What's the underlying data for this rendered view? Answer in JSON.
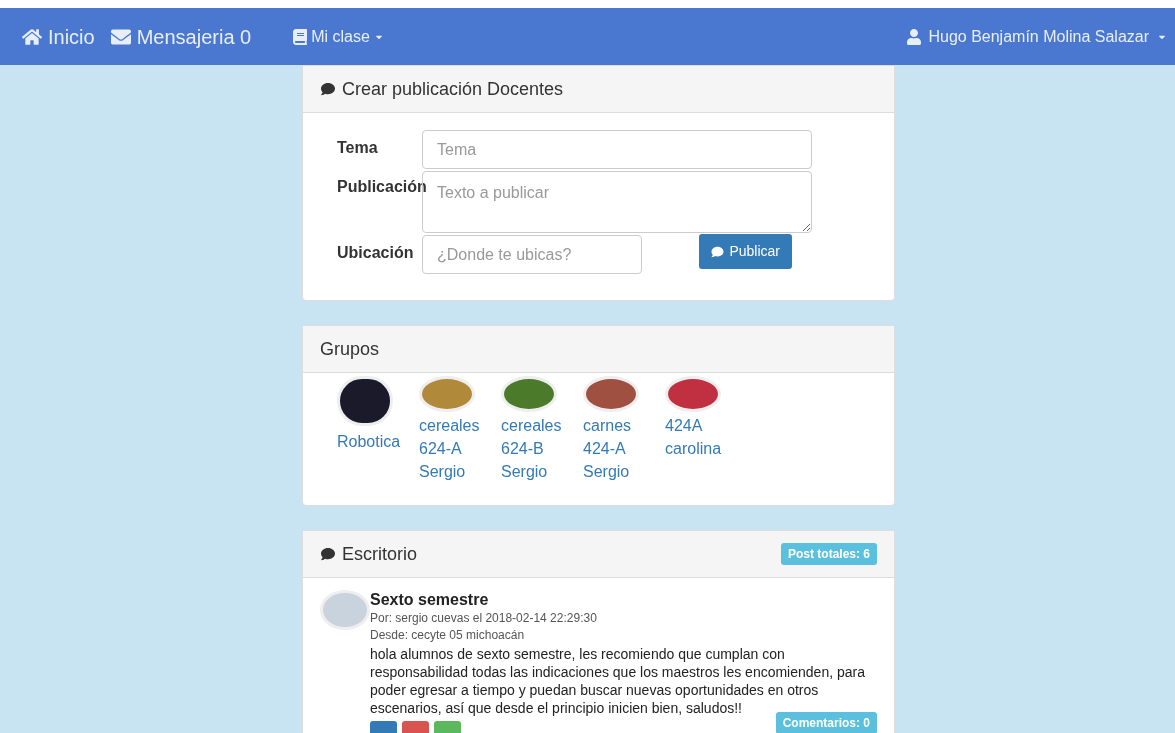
{
  "navbar": {
    "items": [
      {
        "kind": "home",
        "label": "Inicio"
      },
      {
        "kind": "mail",
        "label": "Mensajeria 0"
      },
      {
        "kind": "dropdown",
        "label": "Mi clase"
      }
    ],
    "user": "Hugo Benjamín Molina Salazar"
  },
  "create_post": {
    "title": "Crear publicación Docentes",
    "fields": [
      {
        "label": "Tema",
        "placeholder": "Tema",
        "kind": "input"
      },
      {
        "label": "Publicación",
        "placeholder": "Texto a publicar",
        "kind": "textarea"
      },
      {
        "label": "Ubicación",
        "placeholder": "¿Donde te ubicas?",
        "kind": "short"
      }
    ],
    "submit": "Publicar"
  },
  "groups": {
    "title": "Grupos",
    "items": [
      {
        "name": "Robotica",
        "color": "#1a1a2a"
      },
      {
        "name": "cereales 624-A Sergio",
        "color": "#b08a3a"
      },
      {
        "name": "cereales 624-B Sergio",
        "color": "#4a7a2a"
      },
      {
        "name": "carnes 424-A Sergio",
        "color": "#a05040"
      },
      {
        "name": "424A carolina",
        "color": "#c03040"
      }
    ]
  },
  "desk": {
    "title": "Escritorio",
    "badge": "Post totales: 6",
    "posts": [
      {
        "title": "Sexto semestre",
        "by": "Por: sergio cuevas el 2018-02-14 22:29:30",
        "from": "Desde: cecyte 05 michoacán",
        "body": "hola alumnos de sexto semestre, les recomiendo que cumplan con responsabilidad todas las indicaciones que los maestros les encomienden, para poder egresar a tiempo y puedan buscar nuevas oportunidades en otros escenarios, así que desde el principio inicien bien, saludos!!",
        "comments": "Comentarios: 0"
      }
    ]
  }
}
